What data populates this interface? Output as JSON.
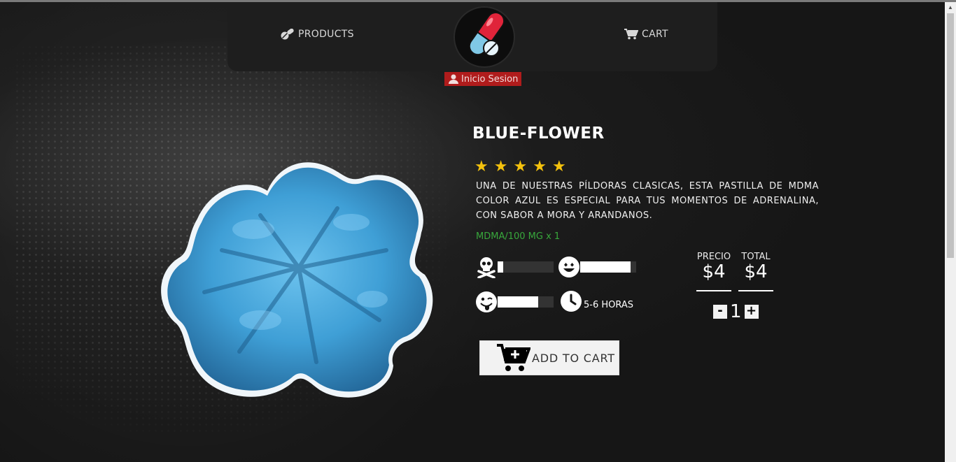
{
  "nav": {
    "products_label": "PRODUCTS",
    "cart_label": "CART",
    "login_label": "Inicio Sesion"
  },
  "product": {
    "name": "BLUE-FLOWER",
    "rating": 5,
    "rating_stars": [
      "★",
      "★",
      "★",
      "★",
      "★"
    ],
    "description": "UNA DE NUESTRAS PÍLDORAS CLASICAS, ESTA PASTILLA DE MDMA COLOR AZUL ES ESPECIAL PARA TUS MOMENTOS DE ADRENALINA, CON SABOR A MORA Y ARANDANOS.",
    "dose": "MDMA/100 MG x 1",
    "effects": {
      "danger_level": 0.1,
      "happy_level": 0.9,
      "crazy_level": 0.72,
      "duration": "5-6 HORAS"
    }
  },
  "pricing": {
    "price_label": "PRECIO",
    "price_value": "$4",
    "total_label": "TOTAL",
    "total_value": "$4",
    "quantity": "1",
    "minus": "-",
    "plus": "+"
  },
  "actions": {
    "add_to_cart": "ADD TO CART"
  },
  "colors": {
    "accent_red": "#b01c1c",
    "dose_green": "#38a83c",
    "star_yellow": "#f4c20d",
    "pill_blue": "#4aa6dc"
  },
  "icons": {
    "products": "pills-icon",
    "cart": "cart-icon",
    "login": "user-icon",
    "danger": "skull-crossbones-icon",
    "happy": "grin-hearts-icon",
    "crazy": "grin-tongue-wink-icon",
    "duration": "clock-icon",
    "add_to_cart": "cart-plus-icon"
  }
}
